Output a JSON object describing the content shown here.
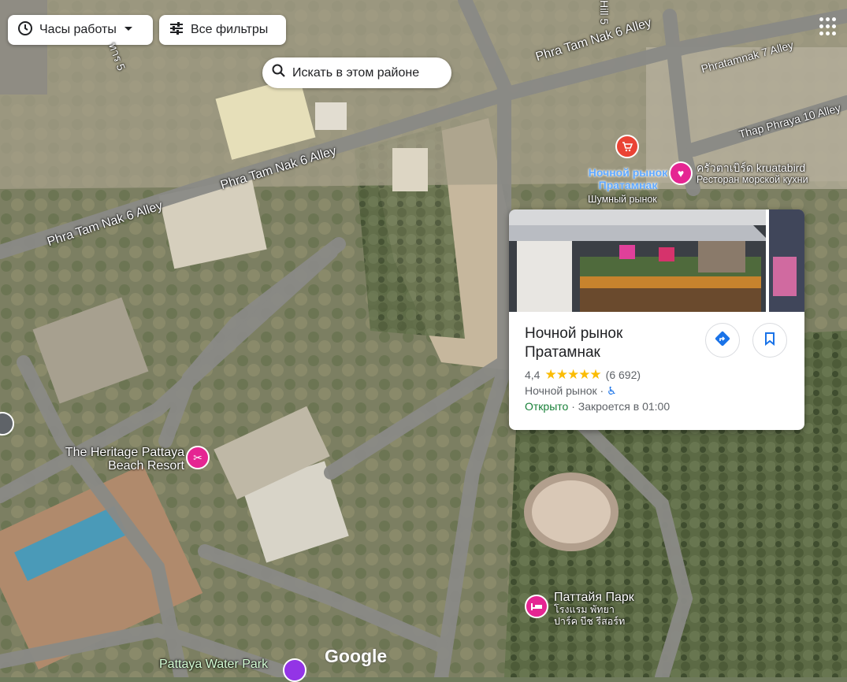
{
  "filters": {
    "hours_label": "Часы работы",
    "all_filters_label": "Все фильтры"
  },
  "search_area_label": "Искать в этом районе",
  "roads": {
    "r1": "Phra Tam Nak 6 Alley",
    "r2": "Phra Tam Nak 6 Alley",
    "r3": "Phra Tam Nak 6 Alley",
    "r4": "Phratamnak 7 Alley",
    "r5": "Thap Phraya 10 Alley",
    "r6": "Hill 5",
    "r7": "ทาร 5"
  },
  "places": {
    "night_market": {
      "name_line1": "Ночной рынок",
      "name_line2": "Пратамнак",
      "note": "Шумный рынок"
    },
    "kruatabird": {
      "name": "ครัวตาเบิร์ด kruatabird",
      "category": "Ресторан морской кухни"
    },
    "heritage": {
      "line1": "The Heritage Pattaya",
      "line2": "Beach Resort"
    },
    "pattaya_park": {
      "name": "Паттайя Парк",
      "thai1": "โรงแรม พัทยา",
      "thai2": "ปาร์ค บีช รีสอร์ท"
    },
    "water_park": {
      "name": "Pattaya Water Park"
    }
  },
  "card": {
    "title": "Ночной рынок Пратамнак",
    "rating": "4,4",
    "stars_value": 4.4,
    "stars": "★★★★★",
    "review_count": "(6 692)",
    "category": "Ночной рынок",
    "category_sep": "·",
    "open_status": "Открыто",
    "hours_sep": "·",
    "closes": "Закроется в 01:00"
  },
  "logo": "Google",
  "colors": {
    "market_pin": "#ea4335",
    "restaurant_pin": "#e52592",
    "hotel_pin": "#e52592",
    "open_green": "#188038",
    "link_blue": "#1a73e8",
    "star_yellow": "#fbbc04"
  }
}
